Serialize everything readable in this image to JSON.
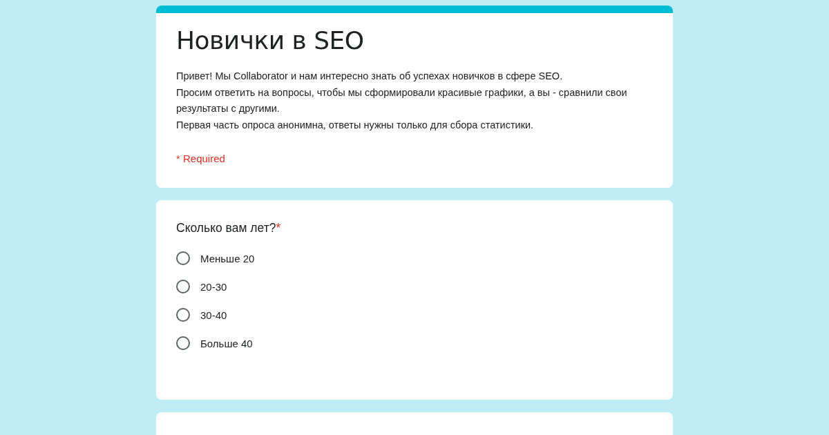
{
  "form": {
    "title": "Новички в SEO",
    "description": [
      "Привет! Мы Collaborator и нам интересно знать об успехах новичков в сфере SEO.",
      "Просим ответить на вопросы, чтобы мы сформировали красивые графики, а вы - сравнили свои результаты с другими.",
      "Первая часть опроса анонимна, ответы нужны только для сбора статистики."
    ],
    "required_note": "* Required"
  },
  "questions": [
    {
      "title": "Сколько вам лет?",
      "required_mark": "*",
      "options": [
        {
          "label": "Меньше 20",
          "selected": false
        },
        {
          "label": "20-30",
          "selected": false
        },
        {
          "label": "30-40",
          "selected": false
        },
        {
          "label": "Больше 40",
          "selected": false
        }
      ]
    }
  ]
}
